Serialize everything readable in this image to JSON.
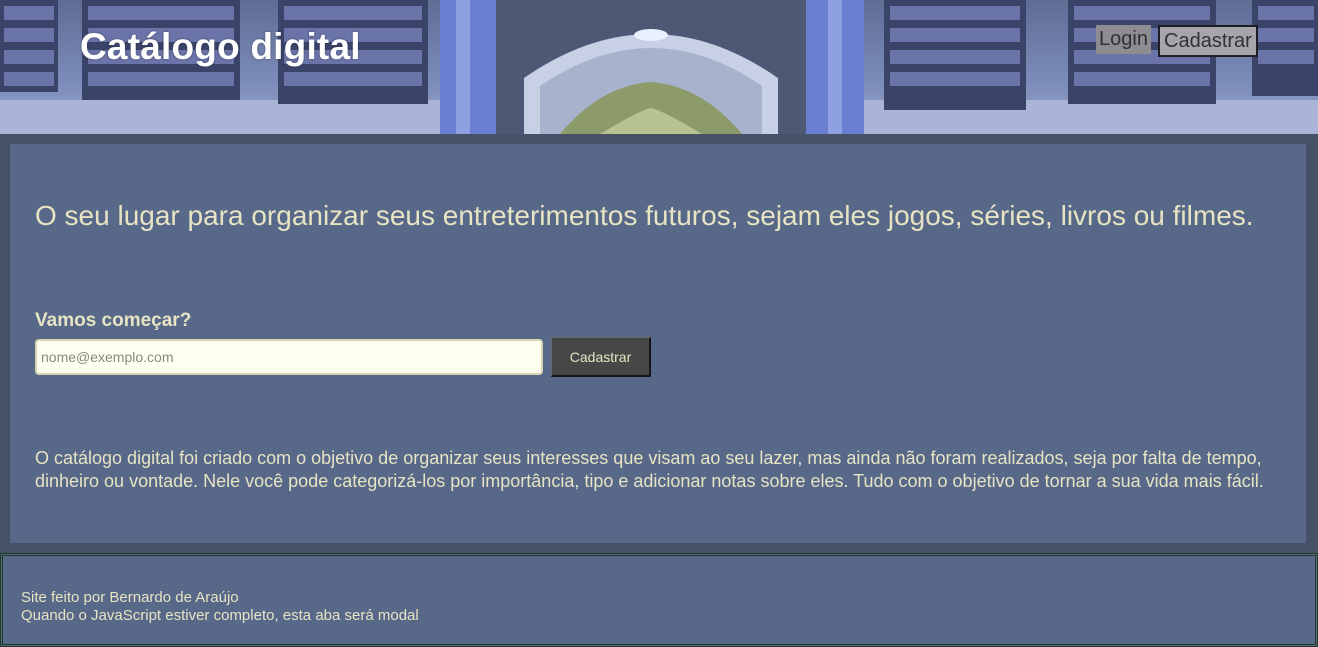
{
  "header": {
    "title": "Catálogo digital",
    "login_label": "Login",
    "signup_label": "Cadastrar"
  },
  "main": {
    "tagline": "O seu lugar para organizar seus entreterimentos futuros, sejam eles jogos, séries, livros ou filmes.",
    "start_label": "Vamos começar?",
    "email_placeholder": "nome@exemplo.com",
    "email_value": "",
    "signup_button": "Cadastrar",
    "description": "O catálogo digital foi criado com o objetivo de organizar seus interesses que visam ao seu lazer, mas ainda não foram realizados, seja por falta de tempo, dinheiro ou vontade. Nele você pode categorizá-los por importância, tipo e adicionar notas sobre eles. Tudo com o objetivo de tornar a sua vida mais fácil."
  },
  "footer": {
    "credit": "Site feito por Bernardo de Araújo",
    "note": "Quando o JavaScript estiver completo, esta aba será modal"
  },
  "colors": {
    "page_bg": "#465066",
    "panel_bg": "#586889",
    "text_cream": "#e6e4c3",
    "button_dark": "#474747",
    "input_bg": "#fefff0"
  }
}
